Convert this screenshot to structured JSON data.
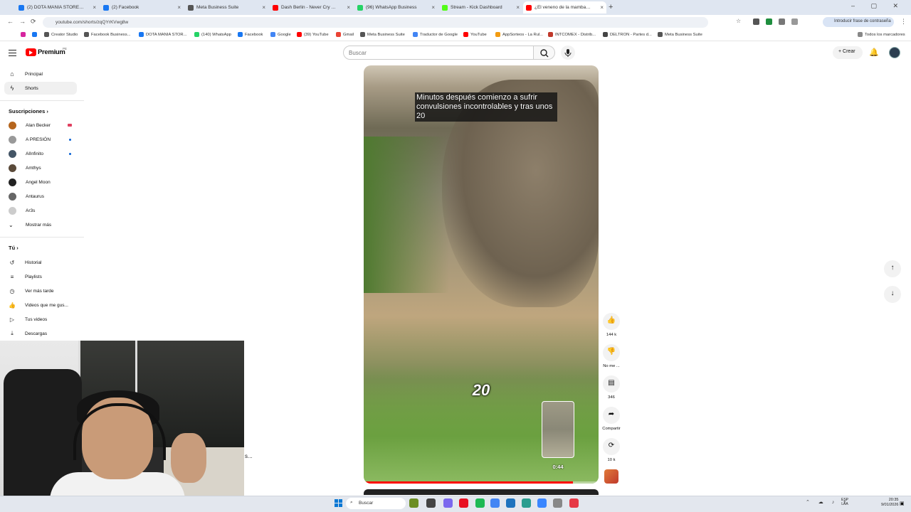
{
  "browser": {
    "tabs": [
      {
        "title": "(2) DOTA MANIA STORE está e...",
        "color": "#1877f2",
        "active": false
      },
      {
        "title": "(2) Facebook",
        "color": "#1877f2",
        "active": false
      },
      {
        "title": "Meta Business Suite",
        "color": "#555555",
        "active": false
      },
      {
        "title": "Dash Berlin - Never Cry Again",
        "color": "#ff0000",
        "active": false
      },
      {
        "title": "(96) WhatsApp Business",
        "color": "#25d366",
        "active": false
      },
      {
        "title": "Stream - Kick Dashboard",
        "color": "#53fc18",
        "active": false
      },
      {
        "title": "¿El veneno de la mamba ne...",
        "color": "#ff0000",
        "active": true
      }
    ],
    "new_tab_glyph": "+",
    "window_controls": "– ▢ ✕",
    "url": "youtube.com/shorts/zqQYrKVwg8w",
    "password_chip": "Introducir frase de contraseña",
    "bookmarks": [
      {
        "label": "",
        "color": "#d6249f"
      },
      {
        "label": "",
        "color": "#1877f2"
      },
      {
        "label": "Creator Studio",
        "color": "#555555"
      },
      {
        "label": "Facebook Business...",
        "color": "#555555"
      },
      {
        "label": "DOTA MANIA STOR...",
        "color": "#1877f2"
      },
      {
        "label": "(140) WhatsApp",
        "color": "#25d366"
      },
      {
        "label": "Facebook",
        "color": "#1877f2"
      },
      {
        "label": "Google",
        "color": "#4285f4"
      },
      {
        "label": "(39) YouTube",
        "color": "#ff0000"
      },
      {
        "label": "Gmail",
        "color": "#ea4335"
      },
      {
        "label": "Meta Business Suite",
        "color": "#555555"
      },
      {
        "label": "Traductor de Google",
        "color": "#4285f4"
      },
      {
        "label": "YouTube",
        "color": "#ff0000"
      },
      {
        "label": "AppSorteos - La Rul...",
        "color": "#f39c12"
      },
      {
        "label": "INTCOMEX - Distrib...",
        "color": "#c0392b"
      },
      {
        "label": "DELTRON - Partes d...",
        "color": "#444444"
      },
      {
        "label": "Meta Business Suite",
        "color": "#555555"
      }
    ],
    "all_bookmarks": "Todos los marcadores"
  },
  "youtube": {
    "logo_text": "Premium",
    "logo_country": "PE",
    "search_placeholder": "Buscar",
    "create_label": "Crear",
    "sidebar": {
      "main": [
        {
          "label": "Principal",
          "icon": "⌂",
          "active": false
        },
        {
          "label": "Shorts",
          "icon": "ϟ",
          "active": true
        }
      ],
      "subs_header": "Suscripciones",
      "subs": [
        {
          "label": "Alan Becker",
          "color": "#b5651d",
          "badge": "live"
        },
        {
          "label": "A PRESIÓN",
          "color": "#999999",
          "badge": "dot"
        },
        {
          "label": "AlInfinito",
          "color": "#445566",
          "badge": "dot"
        },
        {
          "label": "Amthys",
          "color": "#5a4a3a",
          "badge": ""
        },
        {
          "label": "Angel Moon",
          "color": "#222222",
          "badge": ""
        },
        {
          "label": "Antaurus",
          "color": "#666666",
          "badge": ""
        },
        {
          "label": "Ar3s",
          "color": "#cccccc",
          "badge": ""
        }
      ],
      "show_more": "Mostrar más",
      "you_header": "Tú",
      "you": [
        {
          "label": "Historial",
          "icon": "↺"
        },
        {
          "label": "Playlists",
          "icon": "≡"
        },
        {
          "label": "Ver más tarde",
          "icon": "◷"
        },
        {
          "label": "Videos que me gus...",
          "icon": "👍"
        },
        {
          "label": "Tus videos",
          "icon": "▷"
        },
        {
          "label": "Descargas",
          "icon": "⤓"
        }
      ]
    },
    "short": {
      "caption": "Minutos después comienzo a sufrir convulsiones incontrolables y tras unos 20",
      "overlay_number": "20",
      "thumb_time": "0:44",
      "progress": 0.89
    },
    "actions": [
      {
        "icon": "👍",
        "label": "144 k"
      },
      {
        "icon": "👎",
        "label": "No me ..."
      },
      {
        "icon": "▤",
        "label": "346"
      },
      {
        "icon": "➦",
        "label": "Compartir"
      },
      {
        "icon": "⟳",
        "label": "10 k"
      }
    ],
    "nav_up": "↑",
    "nav_down": "↓"
  },
  "webcam": {
    "trailing_text": "s..."
  },
  "taskbar": {
    "search": "Buscar",
    "icons": [
      "#6b8e23",
      "#444444",
      "#7b68ee",
      "#e81123",
      "#1db954",
      "#4285f4",
      "#1e73be",
      "#2a9d8f",
      "#3a86ff",
      "#888888",
      "#e63946"
    ],
    "tray": "⌃ ☁ ♪ ⚡",
    "lang": [
      "ESP",
      "LAA"
    ],
    "time": "20:35",
    "date": "9/01/2026"
  }
}
